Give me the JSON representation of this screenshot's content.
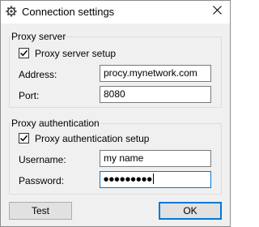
{
  "window": {
    "title": "Connection settings",
    "app_icon": "gear-icon",
    "close_icon": "close-icon"
  },
  "proxy_server": {
    "group_title": "Proxy server",
    "setup_label": "Proxy server setup",
    "setup_checked": true,
    "address_label": "Address:",
    "address_value": "procy.mynetwork.com",
    "port_label": "Port:",
    "port_value": "8080"
  },
  "proxy_auth": {
    "group_title": "Proxy authentication",
    "setup_label": "Proxy authentication setup",
    "setup_checked": true,
    "username_label": "Username:",
    "username_value": "my name",
    "password_label": "Password:",
    "password_mask": "●●●●●●●●●"
  },
  "buttons": {
    "test_label": "Test",
    "ok_label": "OK"
  },
  "colors": {
    "accent": "#0078d7",
    "window_bg": "#f0f0f0"
  }
}
